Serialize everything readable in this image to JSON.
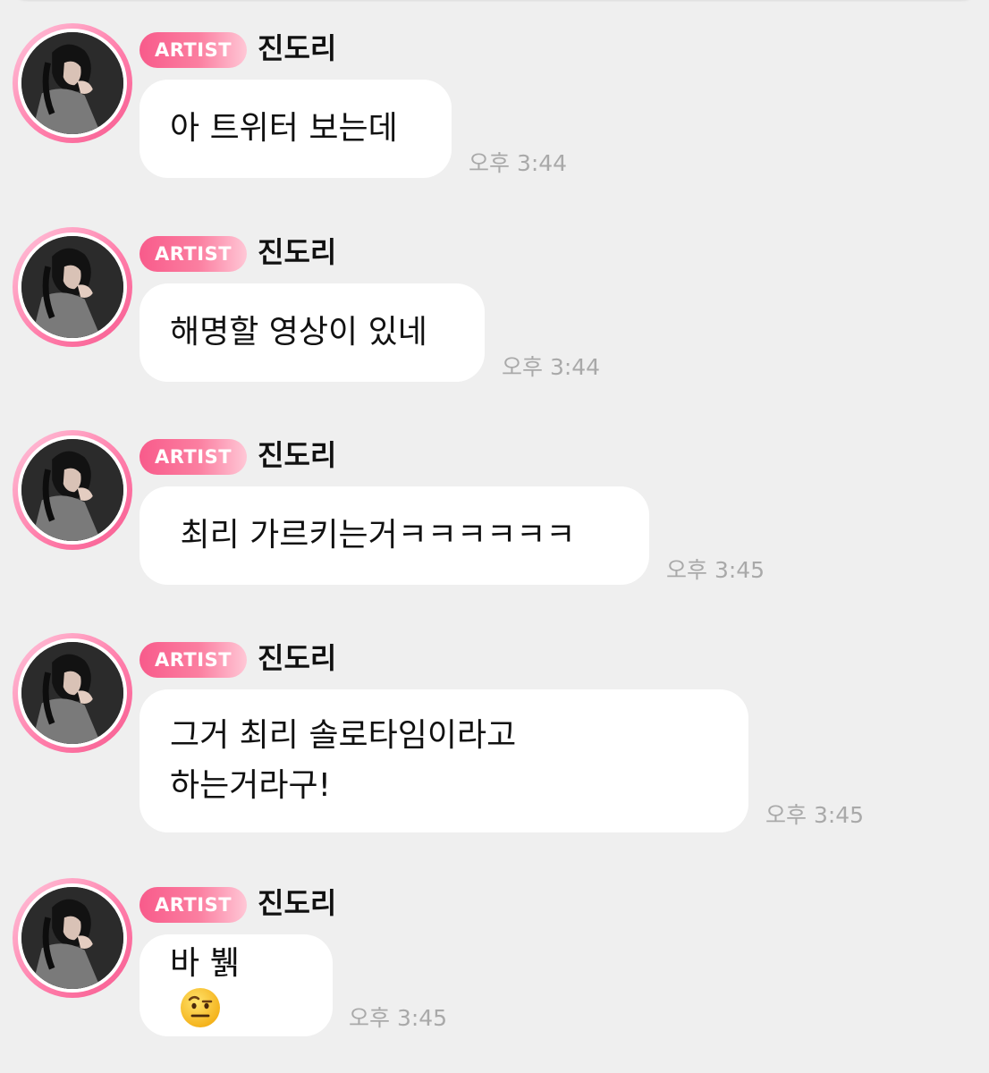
{
  "messages": [
    {
      "badge": "ARTIST",
      "sender": "진도리",
      "lines": [
        "아 트위터 보는데"
      ],
      "time": "오후 3:44"
    },
    {
      "badge": "ARTIST",
      "sender": "진도리",
      "lines": [
        "해명할 영상이 있네"
      ],
      "time": "오후 3:44"
    },
    {
      "badge": "ARTIST",
      "sender": "진도리",
      "lines": [
        " 최리 가르키는거ㅋㅋㅋㅋㅋㅋ"
      ],
      "time": "오후 3:45"
    },
    {
      "badge": "ARTIST",
      "sender": "진도리",
      "lines": [
        "그거 최리 솔로타임이라고",
        "하는거라구!"
      ],
      "time": "오후 3:45"
    },
    {
      "badge": "ARTIST",
      "sender": "진도리",
      "lines": [
        "바 뷁"
      ],
      "time": "오후 3:45",
      "emoji": "raised-eyebrow-face-icon"
    }
  ],
  "colors": {
    "background": "#efefef",
    "bubble": "#ffffff",
    "badge_start": "#f85b8b",
    "badge_end": "#ffc7d6",
    "timestamp": "#a9a9a9",
    "avatar_ring": "#ff7fab"
  }
}
